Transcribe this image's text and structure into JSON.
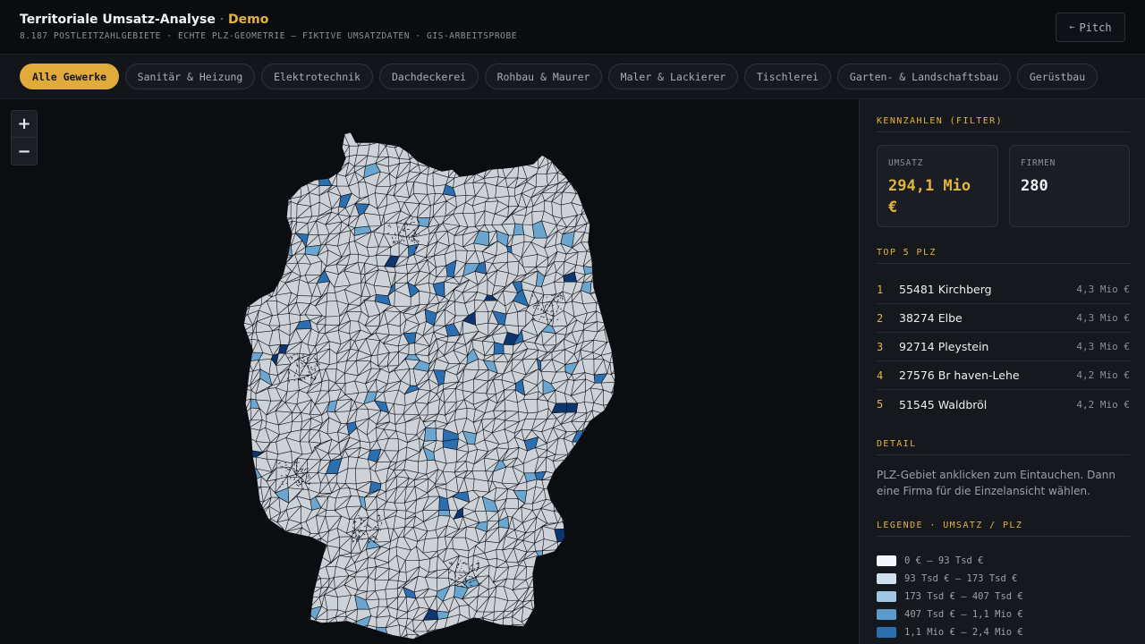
{
  "header": {
    "title": "Territoriale Umsatz-Analyse",
    "title_sep": "·",
    "title_accent": "Demo",
    "subtitle": "8.187 POSTLEITZAHLGEBIETE · ECHTE PLZ-GEOMETRIE — FIKTIVE UMSATZDATEN · GIS-ARBEITSPROBE",
    "pitch_arrow": "←",
    "pitch_label": "Pitch"
  },
  "filters": [
    {
      "label": "Alle Gewerke",
      "active": true
    },
    {
      "label": "Sanitär & Heizung",
      "active": false
    },
    {
      "label": "Elektrotechnik",
      "active": false
    },
    {
      "label": "Dachdeckerei",
      "active": false
    },
    {
      "label": "Rohbau & Maurer",
      "active": false
    },
    {
      "label": "Maler & Lackierer",
      "active": false
    },
    {
      "label": "Tischlerei",
      "active": false
    },
    {
      "label": "Garten- & Landschaftsbau",
      "active": false
    },
    {
      "label": "Gerüstbau",
      "active": false
    }
  ],
  "map": {
    "zoom_in": "+",
    "zoom_out": "−",
    "colors": {
      "land": "#cdd2d9",
      "border": "#0b0d11",
      "hl_light": "#6aa6cf",
      "hl_mid": "#2c6fb0",
      "hl_dark": "#0d3570"
    }
  },
  "sidebar": {
    "kpi_title": "KENNZAHLEN (FILTER)",
    "kpi": {
      "umsatz_label": "UMSATZ",
      "umsatz_value": "294,1 Mio €",
      "firmen_label": "FIRMEN",
      "firmen_value": "280"
    },
    "top_title": "TOP 5 PLZ",
    "top": [
      {
        "rank": "1",
        "name": "55481 Kirchberg",
        "value": "4,3 Mio €"
      },
      {
        "rank": "2",
        "name": "38274 Elbe",
        "value": "4,3 Mio €"
      },
      {
        "rank": "3",
        "name": "92714 Pleystein",
        "value": "4,3 Mio €"
      },
      {
        "rank": "4",
        "name": "27576 Br haven-Lehe",
        "value": "4,2 Mio €"
      },
      {
        "rank": "5",
        "name": "51545 Waldbröl",
        "value": "4,2 Mio €"
      }
    ],
    "detail_title": "DETAIL",
    "detail_text": "PLZ-Gebiet anklicken zum Eintauchen. Dann eine Firma für die Einzelansicht wählen.",
    "legend_title": "LEGENDE · UMSATZ / PLZ",
    "legend": [
      {
        "label": "0 € – 93 Tsd €",
        "color": "#f4f7fb"
      },
      {
        "label": "93 Tsd € – 173 Tsd €",
        "color": "#cfe0ef"
      },
      {
        "label": "173 Tsd € – 407 Tsd €",
        "color": "#9fc6e2"
      },
      {
        "label": "407 Tsd € – 1,1 Mio €",
        "color": "#5b9bcb"
      },
      {
        "label": "1,1 Mio € – 2,4 Mio €",
        "color": "#2b6fb0"
      },
      {
        "label": "",
        "color": "#0d3570"
      }
    ]
  }
}
